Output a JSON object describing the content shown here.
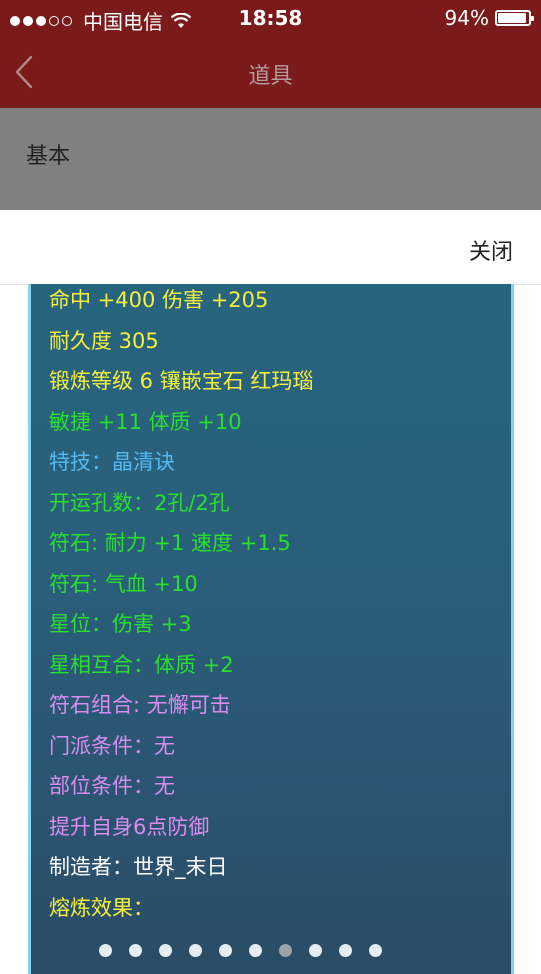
{
  "status_bar": {
    "carrier": "中国电信",
    "time": "18:58",
    "battery": "94%",
    "battery_level": 0.94
  },
  "nav": {
    "title": "道具"
  },
  "tabs": {
    "basic": "基本"
  },
  "sheet": {
    "close_label": "关闭"
  },
  "attributes": [
    {
      "text": "命中 +400 伤害 +205",
      "color": "#f6ef3b"
    },
    {
      "text": "耐久度 305",
      "color": "#f6ef3b"
    },
    {
      "text": "锻炼等级 6 镶嵌宝石 红玛瑙",
      "color": "#f6ef3b"
    },
    {
      "text": "敏捷 +11 体质 +10",
      "color": "#28e02c"
    },
    {
      "text": "特技：晶清诀",
      "color": "#55b9f1"
    },
    {
      "text": "开运孔数：2孔/2孔",
      "color": "#28e02c"
    },
    {
      "text": "符石: 耐力 +1 速度 +1.5",
      "color": "#28e02c"
    },
    {
      "text": "符石: 气血 +10",
      "color": "#28e02c"
    },
    {
      "text": "星位：伤害 +3",
      "color": "#28e02c"
    },
    {
      "text": "星相互合：体质 +2",
      "color": "#28e02c"
    },
    {
      "text": "符石组合: 无懈可击",
      "color": "#d88cf0"
    },
    {
      "text": "门派条件：无",
      "color": "#d88cf0"
    },
    {
      "text": "部位条件：无",
      "color": "#d88cf0"
    },
    {
      "text": "提升自身6点防御",
      "color": "#d88cf0"
    },
    {
      "text": "制造者：世界_末日",
      "color": "#ffffff"
    },
    {
      "text": "熔炼效果：",
      "color": "#f6ef3b"
    }
  ],
  "pager": {
    "count": 10,
    "active_index": 6
  }
}
